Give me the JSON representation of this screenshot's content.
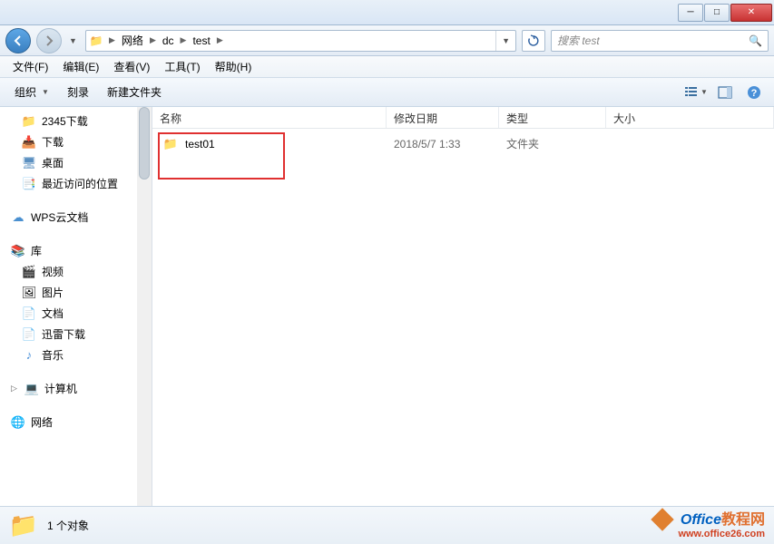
{
  "window": {
    "min_tooltip": "最小化",
    "max_tooltip": "最大化",
    "close_tooltip": "关闭"
  },
  "breadcrumb": {
    "segments": [
      "网络",
      "dc",
      "test"
    ]
  },
  "search": {
    "placeholder": "搜索 test"
  },
  "menubar": {
    "file": "文件(F)",
    "edit": "编辑(E)",
    "view": "查看(V)",
    "tools": "工具(T)",
    "help": "帮助(H)"
  },
  "toolbar": {
    "organize": "组织",
    "burn": "刻录",
    "new_folder": "新建文件夹"
  },
  "sidebar": {
    "downloads_2345": "2345下载",
    "downloads": "下载",
    "desktop": "桌面",
    "recent": "最近访问的位置",
    "wps": "WPS云文档",
    "library": "库",
    "videos": "视频",
    "pictures": "图片",
    "documents": "文档",
    "xunlei": "迅雷下载",
    "music": "音乐",
    "computer": "计算机",
    "network": "网络"
  },
  "columns": {
    "name": "名称",
    "date": "修改日期",
    "type": "类型",
    "size": "大小"
  },
  "files": [
    {
      "name": "test01",
      "date": "2018/5/7 1:33",
      "type": "文件夹",
      "size": ""
    }
  ],
  "status": {
    "count_label": "1 个对象"
  },
  "watermark": {
    "line1a": "Office",
    "line1b": "教程网",
    "line2": "www.office26.com"
  }
}
